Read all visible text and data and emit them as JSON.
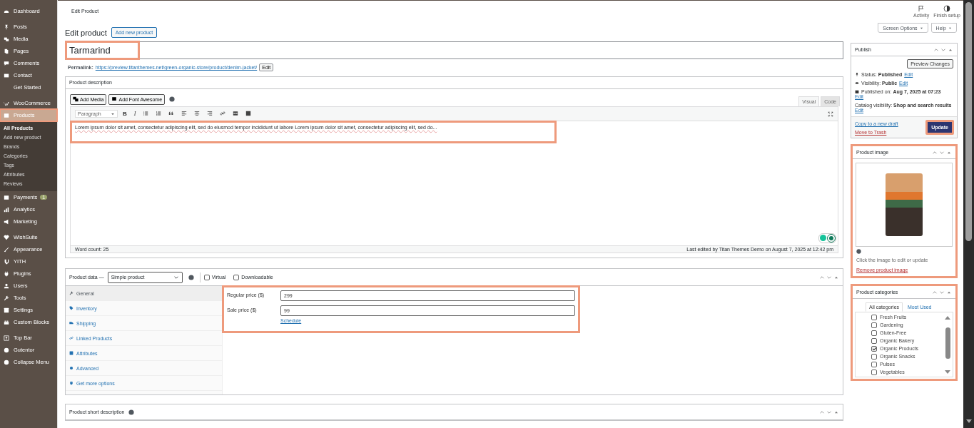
{
  "sidebar": {
    "groups": [
      {
        "items": [
          {
            "label": "Dashboard",
            "kind": "icon",
            "selected": false,
            "highlight": false
          }
        ]
      },
      {
        "items": [
          {
            "label": "Posts",
            "kind": "icon",
            "selected": false,
            "highlight": false
          },
          {
            "label": "Media",
            "kind": "icon",
            "selected": false,
            "highlight": false
          },
          {
            "label": "Pages",
            "kind": "icon",
            "selected": false,
            "highlight": false
          },
          {
            "label": "Comments",
            "kind": "icon",
            "selected": false,
            "highlight": false
          },
          {
            "label": "Contact",
            "kind": "icon",
            "selected": false,
            "highlight": false
          },
          {
            "label": "Get Started",
            "kind": "plain",
            "selected": false,
            "highlight": false
          }
        ]
      },
      {
        "items": [
          {
            "label": "WooCommerce",
            "kind": "icon",
            "selected": false,
            "highlight": false
          },
          {
            "label": "Products",
            "kind": "icon",
            "selected": true,
            "highlight": true,
            "submenu": [
              {
                "label": "All Products",
                "selected": true
              },
              {
                "label": "Add new product",
                "selected": false
              },
              {
                "label": "Brands",
                "selected": false
              },
              {
                "label": "Categories",
                "selected": false
              },
              {
                "label": "Tags",
                "selected": false
              },
              {
                "label": "Attributes",
                "selected": false
              },
              {
                "label": "Reviews",
                "selected": false
              }
            ]
          },
          {
            "label": "Payments",
            "kind": "icon",
            "selected": false,
            "highlight": false,
            "badge": "1"
          },
          {
            "label": "Analytics",
            "kind": "icon",
            "selected": false,
            "highlight": false
          },
          {
            "label": "Marketing",
            "kind": "icon",
            "selected": false,
            "highlight": false
          }
        ]
      },
      {
        "items": [
          {
            "label": "WishSuite",
            "kind": "icon",
            "selected": false,
            "highlight": false
          },
          {
            "label": "Appearance",
            "kind": "icon",
            "selected": false,
            "highlight": false
          },
          {
            "label": "YITH",
            "kind": "icon",
            "selected": false,
            "highlight": false
          },
          {
            "label": "Plugins",
            "kind": "icon",
            "selected": false,
            "highlight": false
          },
          {
            "label": "Users",
            "kind": "icon",
            "selected": false,
            "highlight": false
          },
          {
            "label": "Tools",
            "kind": "icon",
            "selected": false,
            "highlight": false
          },
          {
            "label": "Settings",
            "kind": "icon",
            "selected": false,
            "highlight": false
          },
          {
            "label": "Custom Blocks",
            "kind": "icon",
            "selected": false,
            "highlight": false
          }
        ]
      },
      {
        "items": [
          {
            "label": "Top Bar",
            "kind": "icon",
            "selected": false,
            "highlight": false
          },
          {
            "label": "Gutentor",
            "kind": "icon",
            "selected": false,
            "highlight": false
          },
          {
            "label": "Collapse Menu",
            "kind": "icon",
            "selected": false,
            "highlight": false
          }
        ]
      }
    ]
  },
  "topbar": {
    "title": "Edit Product",
    "actions": [
      {
        "label": "Activity"
      },
      {
        "label": "Finish setup"
      }
    ]
  },
  "screen_buttons": [
    "Screen Options",
    "Help"
  ],
  "heading": {
    "title": "Edit product",
    "button": "Add new product"
  },
  "product_title": {
    "value": "Tarmarind",
    "highlight": true
  },
  "permalink": {
    "label": "Permalink:",
    "url": "https://preview.titanthemes.net/green-organic-store/product/denim-jacket/",
    "button": "Edit"
  },
  "description": {
    "title": "Product description",
    "media_buttons": [
      "Add Media",
      "Add Font Awesome"
    ],
    "tabs": [
      {
        "label": "Visual",
        "selected": true
      },
      {
        "label": "Code",
        "selected": false
      }
    ],
    "format": "Paragraph",
    "toolbar": [
      {
        "kind": "bold",
        "label": "B"
      },
      {
        "kind": "italic",
        "label": "I"
      },
      {
        "kind": "bullet-list"
      },
      {
        "kind": "number-list"
      },
      {
        "kind": "quote"
      },
      {
        "kind": "align-left"
      },
      {
        "kind": "align-center"
      },
      {
        "kind": "align-right"
      },
      {
        "kind": "link"
      },
      {
        "kind": "more"
      },
      {
        "kind": "toolbar-toggle"
      }
    ],
    "content": "Lorem ipsum dolor sit amet, consectetur adipiscing elit, sed do eiusmod tempor incididunt ut labore Lorem ipsum dolor sit amet, consectetur adipiscing elit, sed do...",
    "highlight": true,
    "word_count": "Word count: 25",
    "last_edited": "Last edited by Titan Themes Demo on August 7, 2025 at 12:42 pm"
  },
  "product_data": {
    "label": "Product data —",
    "type": "Simple product",
    "options": [
      {
        "label": "Virtual",
        "checked": false
      },
      {
        "label": "Downloadable",
        "checked": false
      }
    ],
    "tabs": [
      {
        "label": "General",
        "selected": true
      },
      {
        "label": "Inventory",
        "selected": false
      },
      {
        "label": "Shipping",
        "selected": false
      },
      {
        "label": "Linked Products",
        "selected": false
      },
      {
        "label": "Attributes",
        "selected": false
      },
      {
        "label": "Advanced",
        "selected": false
      },
      {
        "label": "Get more options",
        "selected": false
      }
    ],
    "fields": [
      {
        "label": "Regular price ($)",
        "value": "299"
      },
      {
        "label": "Sale price ($)",
        "value": "99",
        "link": "Schedule"
      }
    ],
    "highlight": true
  },
  "short_description": {
    "title": "Product short description"
  },
  "publish": {
    "title": "Publish",
    "preview": "Preview Changes",
    "rows": [
      {
        "kind": "status",
        "label": "Status:",
        "value": "Published",
        "link": "Edit"
      },
      {
        "kind": "visibility",
        "label": "Visibility:",
        "value": "Public",
        "link": "Edit"
      },
      {
        "kind": "date",
        "label": "Published on:",
        "value": "Aug 7, 2025 at 07:23",
        "link": "Edit"
      },
      {
        "kind": "catalog",
        "label": "Catalog visibility:",
        "value": "Shop and search results",
        "link": "Edit"
      }
    ],
    "copy": "Copy to a new draft",
    "trash": "Move to Trash",
    "update": "Update",
    "update_highlight": true
  },
  "product_image": {
    "title": "Product image",
    "hint": "Click the image to edit or update",
    "remove": "Remove product image",
    "highlight": true
  },
  "categories": {
    "title": "Product categories",
    "highlight": true,
    "tabs": [
      {
        "label": "All categories",
        "selected": true
      },
      {
        "label": "Most Used",
        "selected": false
      }
    ],
    "items": [
      {
        "label": "Fresh Fruits",
        "checked": false
      },
      {
        "label": "Gardening",
        "checked": false
      },
      {
        "label": "Gluten-Free",
        "checked": false
      },
      {
        "label": "Organic Bakery",
        "checked": false
      },
      {
        "label": "Organic Products",
        "checked": true
      },
      {
        "label": "Organic Snacks",
        "checked": false
      },
      {
        "label": "Pulses",
        "checked": false
      },
      {
        "label": "Vegetables",
        "checked": false
      }
    ]
  }
}
